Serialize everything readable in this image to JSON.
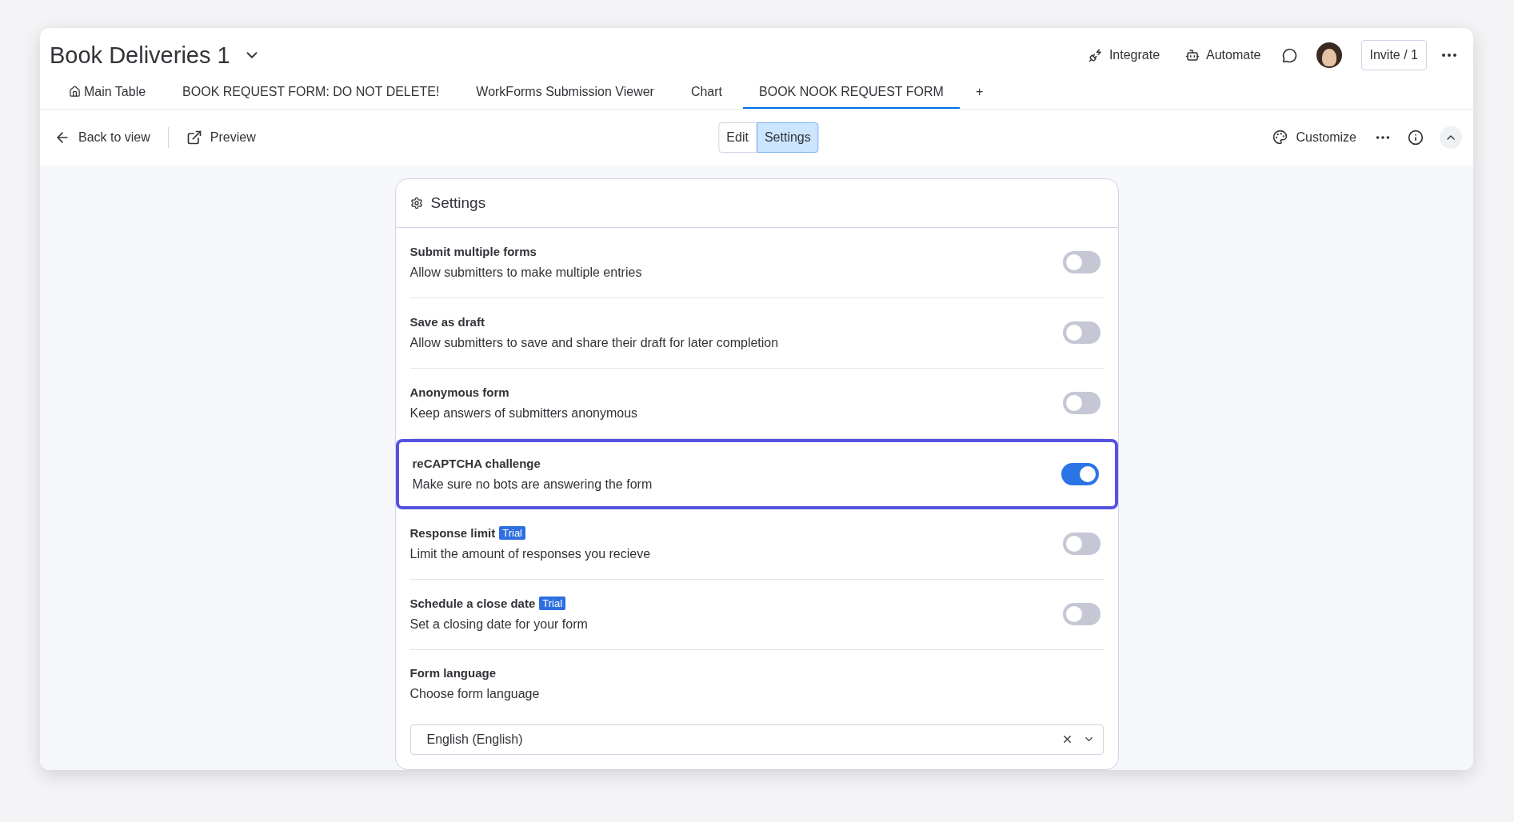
{
  "board": {
    "title": "Book Deliveries 1"
  },
  "header_actions": [
    {
      "kind": "integrate",
      "label": "Integrate"
    },
    {
      "kind": "automate",
      "label": "Automate"
    }
  ],
  "invite": "Invite / 1",
  "tabs": [
    {
      "label": "Main Table",
      "selected": false,
      "kind": "home"
    },
    {
      "label": "BOOK REQUEST FORM: DO NOT DELETE!",
      "selected": false,
      "kind": "plain"
    },
    {
      "label": "WorkForms Submission Viewer",
      "selected": false,
      "kind": "plain"
    },
    {
      "label": "Chart",
      "selected": false,
      "kind": "plain"
    },
    {
      "label": "BOOK NOOK REQUEST FORM",
      "selected": true,
      "kind": "plain"
    }
  ],
  "add_tab": "+",
  "toolbar": {
    "back": "Back to view",
    "preview": "Preview",
    "customize": "Customize",
    "modes": [
      {
        "label": "Edit",
        "selected": false
      },
      {
        "label": "Settings",
        "selected": true
      }
    ]
  },
  "settings": {
    "title": "Settings",
    "items": [
      {
        "title": "Submit multiple forms",
        "description": "Allow submitters to make multiple entries",
        "on": false,
        "highlighted": false
      },
      {
        "title": "Save as draft",
        "description": "Allow submitters to save and share their draft for later completion",
        "on": false,
        "highlighted": false
      },
      {
        "title": "Anonymous form",
        "description": "Keep answers of submitters anonymous",
        "on": false,
        "highlighted": false
      },
      {
        "title": "reCAPTCHA challenge",
        "description": "Make sure no bots are answering the form",
        "on": true,
        "highlighted": true
      },
      {
        "title": "Response limit",
        "badge": "Trial",
        "description": "Limit the amount of responses you recieve",
        "on": false,
        "highlighted": false
      },
      {
        "title": "Schedule a close date",
        "badge": "Trial",
        "description": "Set a closing date for your form",
        "on": false,
        "highlighted": false
      }
    ],
    "language": {
      "title": "Form language",
      "description": "Choose form language",
      "value": "English (English)"
    }
  }
}
